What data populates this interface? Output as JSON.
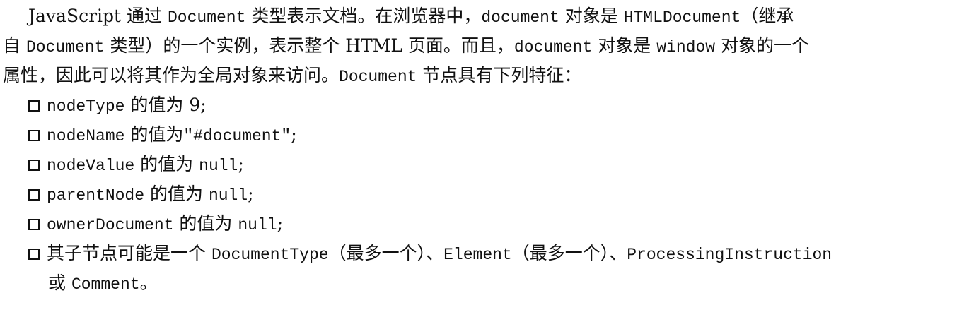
{
  "paragraph": {
    "lines": [
      [
        {
          "t": "text",
          "v": "JavaScript 通过 "
        },
        {
          "t": "code",
          "v": "Document"
        },
        {
          "t": "text",
          "v": " 类型表示文档。在浏览器中，"
        },
        {
          "t": "code",
          "v": "document"
        },
        {
          "t": "text",
          "v": " 对象是 "
        },
        {
          "t": "code",
          "v": "HTMLDocument"
        },
        {
          "t": "text",
          "v": "（继承"
        }
      ],
      [
        {
          "t": "text",
          "v": "自 "
        },
        {
          "t": "code",
          "v": "Document"
        },
        {
          "t": "text",
          "v": " 类型）的一个实例，表示整个 HTML 页面。而且，"
        },
        {
          "t": "code",
          "v": "document"
        },
        {
          "t": "text",
          "v": " 对象是 "
        },
        {
          "t": "code",
          "v": "window"
        },
        {
          "t": "text",
          "v": " 对象的一个"
        }
      ],
      [
        {
          "t": "text",
          "v": "属性，因此可以将其作为全局对象来访问。"
        },
        {
          "t": "code",
          "v": "Document"
        },
        {
          "t": "text",
          "v": " 节点具有下列特征："
        }
      ]
    ]
  },
  "bullets": [
    [
      [
        {
          "t": "code",
          "v": "nodeType"
        },
        {
          "t": "text",
          "v": " 的值为 9;"
        }
      ]
    ],
    [
      [
        {
          "t": "code",
          "v": "nodeName"
        },
        {
          "t": "text",
          "v": " 的值为"
        },
        {
          "t": "code",
          "v": "\"#document\""
        },
        {
          "t": "text",
          "v": ";"
        }
      ]
    ],
    [
      [
        {
          "t": "code",
          "v": "nodeValue"
        },
        {
          "t": "text",
          "v": " 的值为 "
        },
        {
          "t": "code",
          "v": "null"
        },
        {
          "t": "text",
          "v": ";"
        }
      ]
    ],
    [
      [
        {
          "t": "code",
          "v": "parentNode"
        },
        {
          "t": "text",
          "v": " 的值为 "
        },
        {
          "t": "code",
          "v": "null"
        },
        {
          "t": "text",
          "v": ";"
        }
      ]
    ],
    [
      [
        {
          "t": "code",
          "v": "ownerDocument"
        },
        {
          "t": "text",
          "v": " 的值为 "
        },
        {
          "t": "code",
          "v": "null"
        },
        {
          "t": "text",
          "v": ";"
        }
      ]
    ],
    [
      [
        {
          "t": "text",
          "v": "其子节点可能是一个 "
        },
        {
          "t": "code",
          "v": "DocumentType"
        },
        {
          "t": "text",
          "v": "（最多一个）、"
        },
        {
          "t": "code",
          "v": "Element"
        },
        {
          "t": "text",
          "v": "（最多一个）、"
        },
        {
          "t": "code",
          "v": "ProcessingInstruction"
        }
      ],
      [
        {
          "t": "text",
          "v": "或 "
        },
        {
          "t": "code",
          "v": "Comment"
        },
        {
          "t": "text",
          "v": "。"
        }
      ]
    ]
  ],
  "bullet_icon": "hollow-square-icon"
}
